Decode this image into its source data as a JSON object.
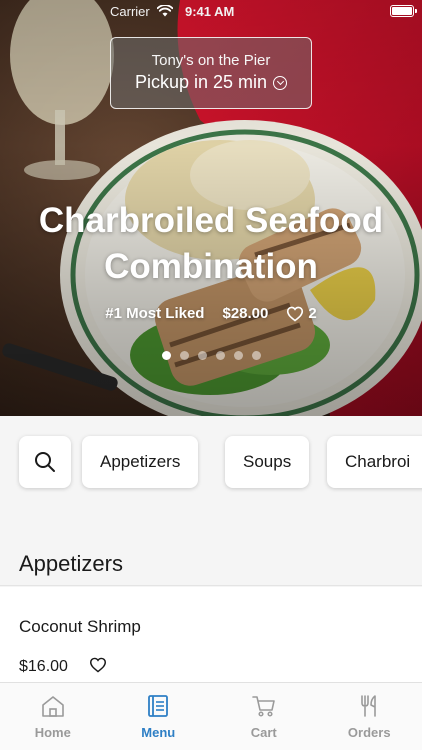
{
  "status_bar": {
    "carrier": "Carrier",
    "time": "9:41 AM"
  },
  "hero": {
    "restaurant_name": "Tony's on the Pier",
    "pickup_label": "Pickup in 25 min",
    "dish_title_line1": "Charbroiled Seafood",
    "dish_title_line2": "Combination",
    "badge": "#1 Most Liked",
    "price": "$28.00",
    "likes": "2",
    "carousel": {
      "count": 6,
      "active_index": 0
    }
  },
  "categories": [
    "Appetizers",
    "Soups",
    "Charbroi"
  ],
  "section": {
    "title": "Appetizers"
  },
  "items": [
    {
      "name": "Coconut Shrimp",
      "price": "$16.00"
    }
  ],
  "tabs": [
    {
      "label": "Home",
      "icon": "house-icon",
      "active": false
    },
    {
      "label": "Menu",
      "icon": "menu-book-icon",
      "active": true
    },
    {
      "label": "Cart",
      "icon": "cart-icon",
      "active": false
    },
    {
      "label": "Orders",
      "icon": "fork-knife-icon",
      "active": false
    }
  ],
  "colors": {
    "accent": "#2e7fc5",
    "inactive_tab": "#9a9a9a",
    "tablecloth_red": "#c8102e"
  }
}
